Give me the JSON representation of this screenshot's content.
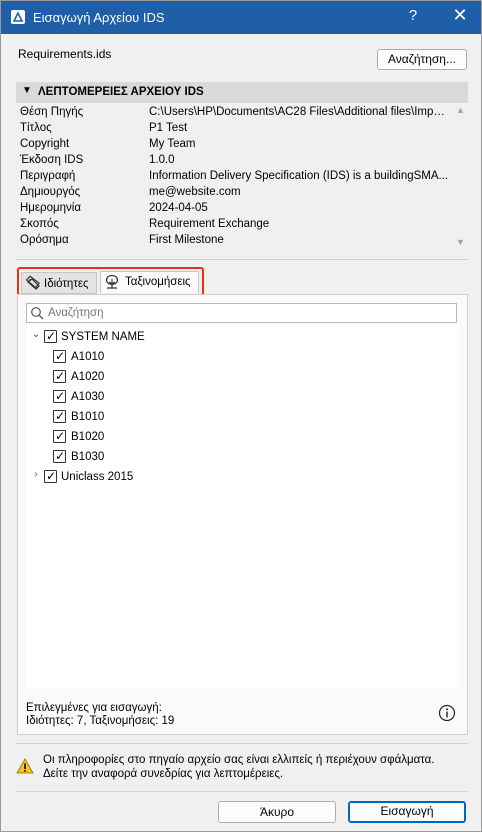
{
  "window": {
    "title": "Εισαγωγή Αρχείου IDS",
    "help": "?",
    "close": "✕"
  },
  "file": {
    "name": "Requirements.ids",
    "browse_label": "Αναζήτηση..."
  },
  "details": {
    "header": "ΛΕΠΤΟΜΕΡΕΙΕΣ ΑΡΧΕΙΟΥ IDS",
    "rows": [
      {
        "key": "Θέση Πηγής",
        "value": "C:\\Users\\HP\\Documents\\AC28 Files\\Additional files\\Impo..."
      },
      {
        "key": "Τίτλος",
        "value": "P1 Test"
      },
      {
        "key": "Copyright",
        "value": "My Team"
      },
      {
        "key": "Έκδοση IDS",
        "value": "1.0.0"
      },
      {
        "key": "Περιγραφή",
        "value": "Information Delivery Specification (IDS) is a buildingSMA..."
      },
      {
        "key": "Δημιουργός",
        "value": "me@website.com"
      },
      {
        "key": "Ημερομηνία",
        "value": "2024-04-05"
      },
      {
        "key": "Σκοπός",
        "value": "Requirement Exchange"
      },
      {
        "key": "Ορόσημα",
        "value": "First Milestone"
      }
    ]
  },
  "tabs": {
    "properties": "Ιδιότητες",
    "classifications": "Ταξινομήσεις",
    "active": "classifications"
  },
  "search": {
    "placeholder": "Αναζήτηση"
  },
  "tree": {
    "root1": {
      "label": "SYSTEM NAME",
      "expanded": true,
      "checked": true
    },
    "children": [
      {
        "label": "A1010",
        "checked": true
      },
      {
        "label": "A1020",
        "checked": true
      },
      {
        "label": "A1030",
        "checked": true
      },
      {
        "label": "B1010",
        "checked": true
      },
      {
        "label": "B1020",
        "checked": true
      },
      {
        "label": "B1030",
        "checked": true
      }
    ],
    "root2": {
      "label": "Uniclass 2015",
      "expanded": false,
      "checked": true
    }
  },
  "summary": {
    "line1": "Επιλεγμένες για εισαγωγή:",
    "line2": "Ιδιότητες: 7, Ταξινομήσεις: 19"
  },
  "warning": {
    "line1": "Οι πληροφορίες στο πηγαίο αρχείο σας είναι ελλιπείς ή περιέχουν σφάλματα.",
    "line2": "Δείτε την αναφορά συνεδρίας για λεπτομέρειες."
  },
  "buttons": {
    "cancel": "Άκυρο",
    "import": "Εισαγωγή"
  },
  "colors": {
    "titlebar": "#1f5fa8",
    "highlight": "#e8311b",
    "accent": "#0067c0",
    "warning": "#f5c518"
  }
}
